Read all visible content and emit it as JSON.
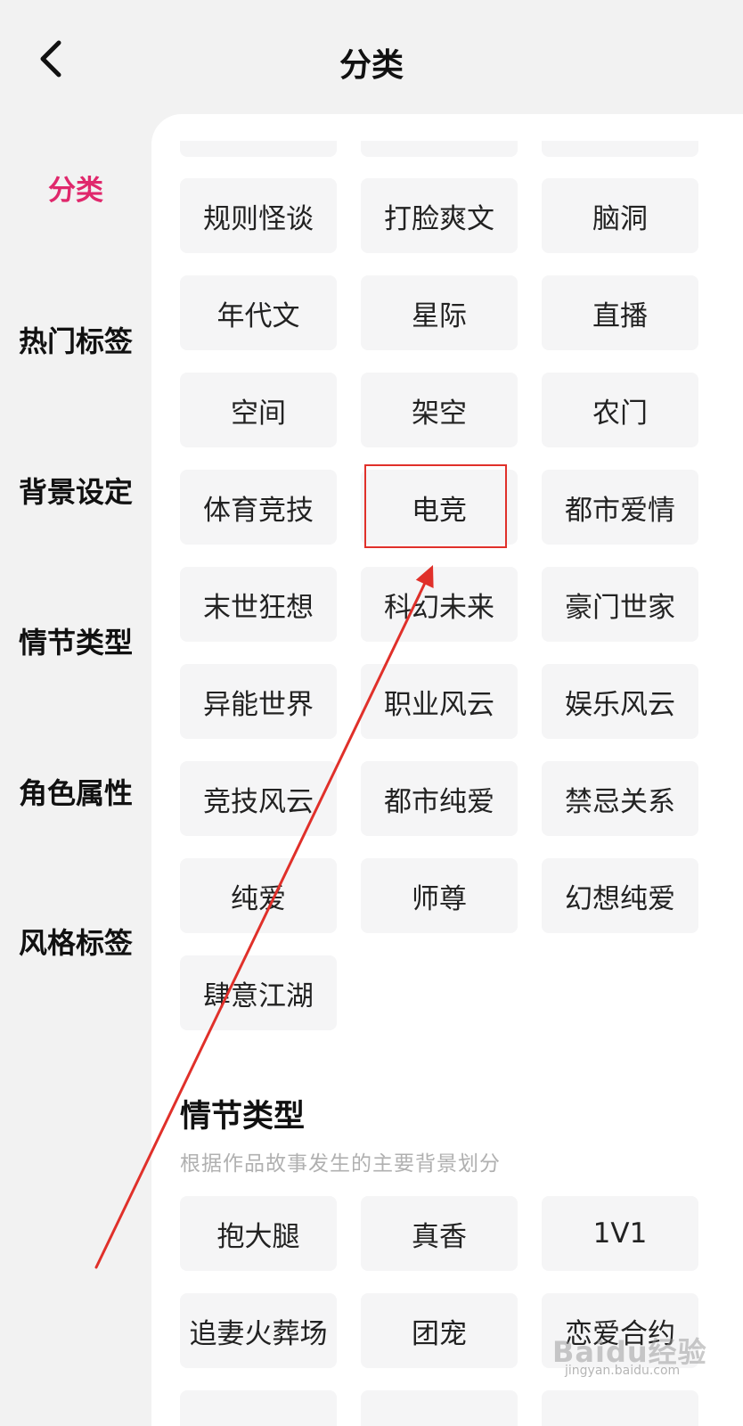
{
  "header": {
    "title": "分类",
    "back_icon": "chevron-left-icon"
  },
  "sidebar": {
    "items": [
      {
        "label": "分类",
        "active": true
      },
      {
        "label": "热门标签",
        "active": false
      },
      {
        "label": "背景设定",
        "active": false
      },
      {
        "label": "情节类型",
        "active": false
      },
      {
        "label": "角色属性",
        "active": false
      },
      {
        "label": "风格标签",
        "active": false
      }
    ],
    "active_color": "#e0286c"
  },
  "categories": {
    "tags": [
      "规则怪谈",
      "打脸爽文",
      "脑洞",
      "年代文",
      "星际",
      "直播",
      "空间",
      "架空",
      "农门",
      "体育竞技",
      "电竞",
      "都市爱情",
      "末世狂想",
      "科幻未来",
      "豪门世家",
      "异能世界",
      "职业风云",
      "娱乐风云",
      "竞技风云",
      "都市纯爱",
      "禁忌关系",
      "纯爱",
      "师尊",
      "幻想纯爱",
      "肆意江湖"
    ],
    "highlighted": "电竞"
  },
  "plot_section": {
    "title": "情节类型",
    "description": "根据作品故事发生的主要背景划分",
    "tags": [
      "抱大腿",
      "真香",
      "1V1",
      "追妻火葬场",
      "团宠",
      "恋爱合约"
    ]
  },
  "annotation": {
    "color": "#e0302a"
  },
  "watermark": {
    "logo": "Baidu经验",
    "url": "jingyan.baidu.com"
  }
}
